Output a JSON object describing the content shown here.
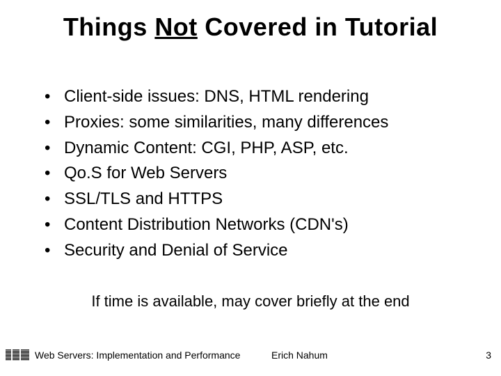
{
  "title": {
    "pre": "Things ",
    "underlined": "Not",
    "post": " Covered in Tutorial"
  },
  "bullets": [
    "Client-side issues: DNS, HTML rendering",
    "Proxies: some similarities, many differences",
    "Dynamic Content: CGI, PHP, ASP, etc.",
    "Qo.S for Web Servers",
    "SSL/TLS and HTTPS",
    "Content Distribution Networks (CDN's)",
    "Security and Denial of Service"
  ],
  "closing": "If time is available, may cover briefly at the end",
  "footer": {
    "title": "Web Servers: Implementation and Performance",
    "author": "Erich Nahum",
    "page": "3"
  },
  "icons": {
    "logo": "ibm-logo"
  }
}
